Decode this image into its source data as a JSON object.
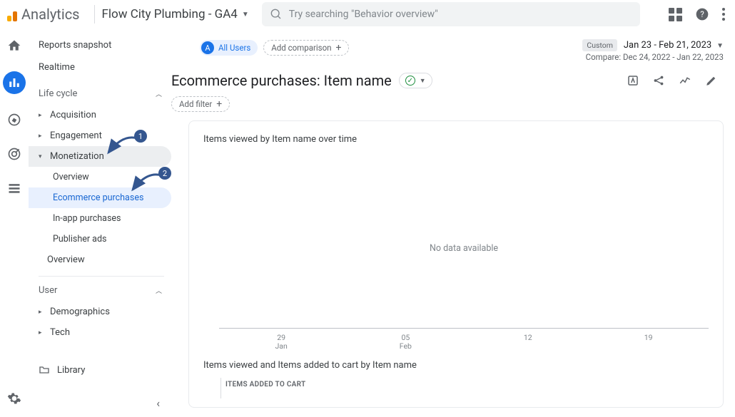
{
  "header": {
    "brand": "Analytics",
    "property": "Flow City Plumbing - GA4",
    "search_placeholder": "Try searching \"Behavior overview\""
  },
  "date": {
    "custom_label": "Custom",
    "range": "Jan 23 - Feb 21, 2023",
    "compare": "Compare: Dec 24, 2022 - Jan 22, 2023"
  },
  "comparison": {
    "all_users_letter": "A",
    "all_users": "All Users",
    "add_comparison": "Add comparison"
  },
  "nav": {
    "reports_snapshot": "Reports snapshot",
    "realtime": "Realtime",
    "life_cycle": "Life cycle",
    "acquisition": "Acquisition",
    "engagement": "Engagement",
    "monetization": "Monetization",
    "mon_overview": "Overview",
    "mon_ecom": "Ecommerce purchases",
    "mon_inapp": "In-app purchases",
    "mon_pub": "Publisher ads",
    "overview": "Overview",
    "user": "User",
    "demographics": "Demographics",
    "tech": "Tech",
    "library": "Library"
  },
  "annotations": {
    "one": "1",
    "two": "2"
  },
  "page": {
    "title": "Ecommerce purchases: Item name",
    "add_filter": "Add filter",
    "card1_title": "Items viewed by Item name over time",
    "no_data": "No data available",
    "card2_title": "Items viewed and Items added to cart by Item name",
    "col_header": "ITEMS ADDED TO CART"
  },
  "chart_data": {
    "type": "line",
    "title": "Items viewed by Item name over time",
    "series": [],
    "no_data_message": "No data available",
    "x_ticks": [
      {
        "top": "29",
        "bottom": "Jan"
      },
      {
        "top": "05",
        "bottom": "Feb"
      },
      {
        "top": "12",
        "bottom": ""
      },
      {
        "top": "19",
        "bottom": ""
      }
    ],
    "xlabel": "",
    "ylabel": ""
  }
}
